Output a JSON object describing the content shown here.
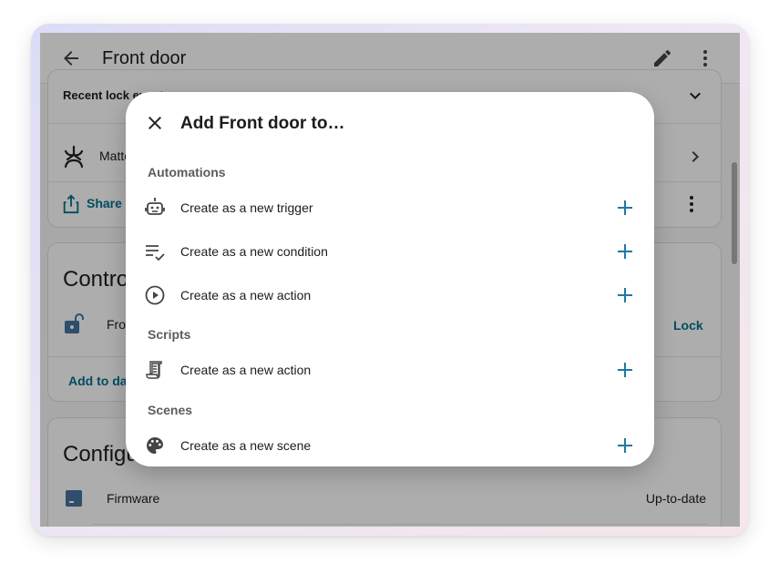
{
  "header": {
    "title": "Front door",
    "back_icon": "arrow-left-icon",
    "edit_icon": "pencil-icon",
    "more_icon": "dots-vertical-icon"
  },
  "background": {
    "recent_lock": "Recent lock events",
    "matter_label": "Matter",
    "share_label": "Share diagnostics",
    "controls_title": "Controls",
    "front_label": "Front door",
    "lock_button": "Lock",
    "add_dashboard": "Add to dashboard",
    "config_title": "Configuration",
    "firmware_label": "Firmware",
    "firmware_status": "Up-to-date"
  },
  "dialog": {
    "title": "Add Front door to…",
    "close_icon": "close-icon",
    "sections": [
      {
        "header": "Automations",
        "items": [
          {
            "label": "Create as a new trigger",
            "icon": "robot-icon"
          },
          {
            "label": "Create as a new condition",
            "icon": "format-list-checks-icon"
          },
          {
            "label": "Create as a new action",
            "icon": "play-circle-outline-icon"
          }
        ]
      },
      {
        "header": "Scripts",
        "items": [
          {
            "label": "Create as a new action",
            "icon": "script-text-icon"
          }
        ]
      },
      {
        "header": "Scenes",
        "items": [
          {
            "label": "Create as a new scene",
            "icon": "palette-icon"
          }
        ]
      }
    ]
  },
  "colors": {
    "accent": "#03718f",
    "plus": "#03a9f4",
    "overlay": "rgba(0,0,0,0.32)"
  }
}
